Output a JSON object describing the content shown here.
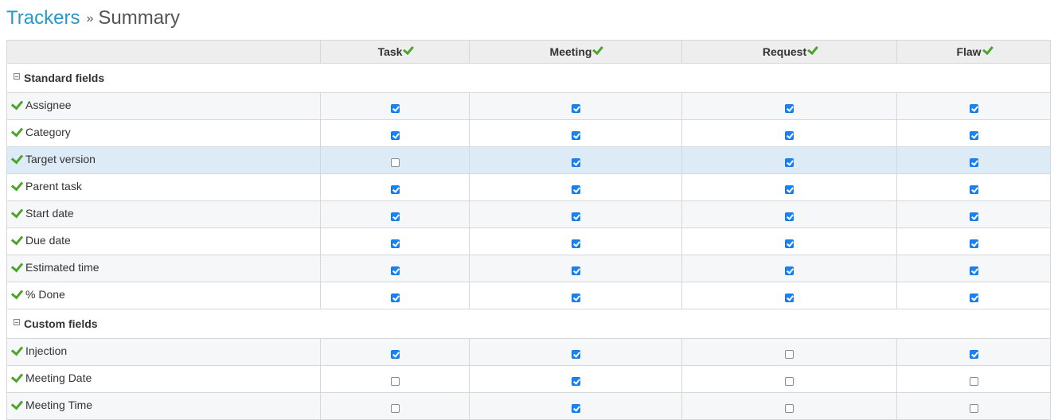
{
  "breadcrumb": {
    "root": "Trackers",
    "separator": "»",
    "current": "Summary"
  },
  "columns": [
    "Task",
    "Meeting",
    "Request",
    "Flaw"
  ],
  "groups": [
    {
      "label": "Standard fields",
      "rows": [
        {
          "label": "Assignee",
          "values": [
            true,
            true,
            true,
            true
          ]
        },
        {
          "label": "Category",
          "values": [
            true,
            true,
            true,
            true
          ]
        },
        {
          "label": "Target version",
          "values": [
            false,
            true,
            true,
            true
          ],
          "highlighted": true
        },
        {
          "label": "Parent task",
          "values": [
            true,
            true,
            true,
            true
          ]
        },
        {
          "label": "Start date",
          "values": [
            true,
            true,
            true,
            true
          ]
        },
        {
          "label": "Due date",
          "values": [
            true,
            true,
            true,
            true
          ]
        },
        {
          "label": "Estimated time",
          "values": [
            true,
            true,
            true,
            true
          ]
        },
        {
          "label": "% Done",
          "values": [
            true,
            true,
            true,
            true
          ]
        }
      ]
    },
    {
      "label": "Custom fields",
      "rows": [
        {
          "label": "Injection",
          "values": [
            true,
            true,
            false,
            true
          ]
        },
        {
          "label": "Meeting Date",
          "values": [
            false,
            true,
            false,
            false
          ]
        },
        {
          "label": "Meeting Time",
          "values": [
            false,
            true,
            false,
            false
          ]
        }
      ]
    }
  ],
  "colors": {
    "link": "#2996cc",
    "check": "#4aa52a",
    "checkbox_on": "#1a82f7",
    "highlight_row": "#dcebf5"
  }
}
